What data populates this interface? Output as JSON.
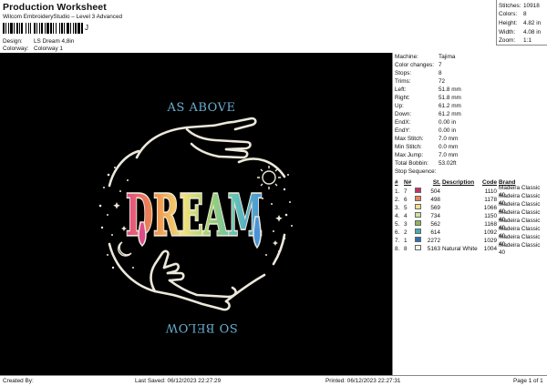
{
  "header": {
    "title": "Production Worksheet",
    "subtitle": "Wilcom EmbroideryStudio – Level 3 Advanced",
    "barcode_suffix": "J",
    "design_label": "Design:",
    "design_value": "LS Dream 4,8in",
    "colorway_label": "Colorway:",
    "colorway_value": "Colorway 1"
  },
  "stats": [
    {
      "label": "Stitches:",
      "value": "10918"
    },
    {
      "label": "Colors:",
      "value": "8"
    },
    {
      "label": "Height:",
      "value": "4.82 in"
    },
    {
      "label": "Width:",
      "value": "4.08 in"
    },
    {
      "label": "Zoom:",
      "value": "1:1"
    }
  ],
  "artwork": {
    "top_text": "AS ABOVE",
    "bottom_text": "SO BELOW",
    "word": "DREAM",
    "colors": {
      "background": "#000000",
      "outline": "#ece8da",
      "text_blue": "#69aed0",
      "pink": "#e04a8a",
      "orange": "#f08a4a",
      "yellow": "#f3e27a",
      "green": "#9fcf72",
      "teal": "#62c2b8",
      "blue": "#4a93d8"
    }
  },
  "info": [
    {
      "label": "Machine:",
      "value": "Tajima"
    },
    {
      "label": "Color changes:",
      "value": "7"
    },
    {
      "label": "Stops:",
      "value": "8"
    },
    {
      "label": "Trims:",
      "value": "72"
    },
    {
      "label": "Left:",
      "value": "51.8 mm"
    },
    {
      "label": "Right:",
      "value": "51.8 mm"
    },
    {
      "label": "Up:",
      "value": "61.2 mm"
    },
    {
      "label": "Down:",
      "value": "61.2 mm"
    },
    {
      "label": "EndX:",
      "value": "0.00 in"
    },
    {
      "label": "EndY:",
      "value": "0.00 in"
    },
    {
      "label": "Max Stitch:",
      "value": "7.0 mm"
    },
    {
      "label": "Min Stitch:",
      "value": "0.0 mm"
    },
    {
      "label": "Max Jump:",
      "value": "7.0 mm"
    },
    {
      "label": "Total Bobbin:",
      "value": "53.02ft"
    }
  ],
  "sequence": {
    "title": "Stop Sequence:",
    "headers": {
      "num": "#",
      "n": "N#",
      "st": "St.",
      "desc": "Description",
      "code": "Code",
      "brand": "Brand"
    },
    "rows": [
      {
        "num": "1.",
        "n": "7",
        "color": "#c8306a",
        "st": "504",
        "desc": "",
        "code": "1110",
        "brand": "Madeira Classic 40"
      },
      {
        "num": "2.",
        "n": "6",
        "color": "#f0805a",
        "st": "498",
        "desc": "",
        "code": "1178",
        "brand": "Madeira Classic 40"
      },
      {
        "num": "3.",
        "n": "5",
        "color": "#f4e08c",
        "st": "569",
        "desc": "",
        "code": "1066",
        "brand": "Madeira Classic 40"
      },
      {
        "num": "4.",
        "n": "4",
        "color": "#cde3a0",
        "st": "734",
        "desc": "",
        "code": "1150",
        "brand": "Madeira Classic 40"
      },
      {
        "num": "5.",
        "n": "3",
        "color": "#8fb45a",
        "st": "562",
        "desc": "",
        "code": "1168",
        "brand": "Madeira Classic 40"
      },
      {
        "num": "6.",
        "n": "2",
        "color": "#3fb0ae",
        "st": "614",
        "desc": "",
        "code": "1092",
        "brand": "Madeira Classic 40"
      },
      {
        "num": "7.",
        "n": "1",
        "color": "#2a6fb8",
        "st": "2272",
        "desc": "",
        "code": "1029",
        "brand": "Madeira Classic 40"
      },
      {
        "num": "8.",
        "n": "8",
        "color": "#f4f4f0",
        "st": "5163",
        "desc": "Natural White",
        "code": "1004",
        "brand": "Madeira Classic 40"
      }
    ]
  },
  "footer": {
    "created_by": "Created By:",
    "last_saved": "Last Saved: 06/12/2023 22:27:29",
    "printed": "Printed: 06/12/2023 22:27:31",
    "page": "Page 1 of 1"
  }
}
